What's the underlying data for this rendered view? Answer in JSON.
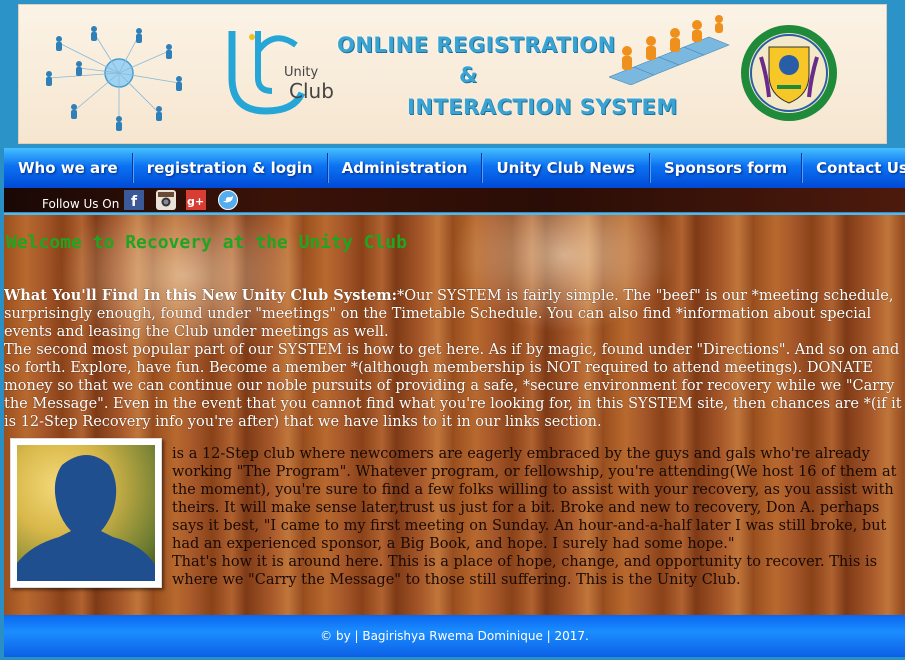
{
  "header": {
    "logo_text_line1": "Unity",
    "logo_text_line2": "Club",
    "title_line1": "ONLINE REGISTRATION",
    "title_amp": "&",
    "title_line2": "INTERACTION SYSTEM",
    "icons": [
      "people-network-icon",
      "people-chain-icon",
      "coat-of-arms-icon"
    ]
  },
  "nav": {
    "items": [
      {
        "label": "Who we are"
      },
      {
        "label": "registration & login"
      },
      {
        "label": "Administration"
      },
      {
        "label": "Unity Club News"
      },
      {
        "label": "Sponsors form"
      },
      {
        "label": "Contact Us"
      }
    ]
  },
  "follow": {
    "label": "Follow Us On",
    "icons": [
      "facebook-icon",
      "instagram-icon",
      "google-plus-icon",
      "twitter-icon"
    ]
  },
  "main": {
    "welcome": "Welcome to Recovery at the Unity Club",
    "intro_bold": "What You'll Find In this New Unity Club System:",
    "intro_p1": "*Our SYSTEM is fairly simple. The \"beef\" is our *meeting schedule, surprisingly enough, found under \"meetings\" on the Timetable Schedule. You can also find *information about special events and leasing the Club under meetings as well.",
    "intro_p2": "The second most popular part of our SYSTEM is how to get here. As if by magic, found under \"Directions\". And so on and so forth. Explore, have fun. Become a member *(although membership is NOT required to attend meetings). DONATE money so that we can continue our noble pursuits of providing a safe, *secure environment for recovery while we \"Carry the Message\". Even in the event that you cannot find what you're looking for, in this SYSTEM site, then chances are *(if it is 12-Step Recovery info you're after) that we have links to it in our links section.",
    "body_p1": "is a 12-Step club where newcomers are eagerly embraced by the guys and gals who're already working \"The Program\". Whatever program, or fellowship, you're attending(We host 16 of them at the moment), you're sure to find a few folks willing to assist with your recovery, as you assist with theirs. It will make sense later,trust us just for a bit. Broke and new to recovery, Don A. perhaps says it best, \"I came to my first meeting on Sunday. An hour-and-a-half later I was still broke, but had an experienced sponsor, a Big Book, and hope. I surely had some hope.\"",
    "body_p2": "That's how it is around here. This is a place of hope, change, and opportunity to recover. This is where we \"Carry the Message\" to those still suffering. This is the Unity Club."
  },
  "footer": {
    "text": "© by | Bagirishya Rwema Dominique | 2017."
  },
  "colors": {
    "nav_blue": "#0c72f2",
    "welcome_green": "#1fa51f",
    "title_blue": "#3aa3d1"
  }
}
